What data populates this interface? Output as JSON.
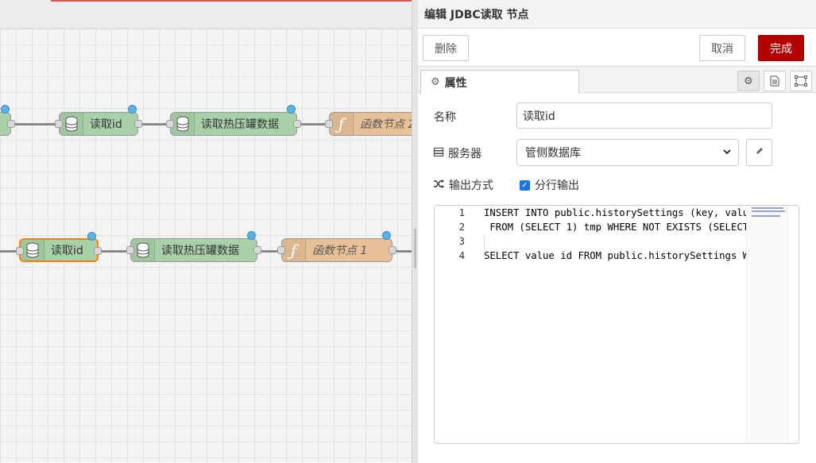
{
  "canvas": {
    "flow_top": {
      "nodes": [
        {
          "label": "读取id",
          "type": "db"
        },
        {
          "label": "读取热压罐数据",
          "type": "db"
        },
        {
          "label": "函数节点 2",
          "type": "function"
        }
      ]
    },
    "flow_bottom": {
      "nodes": [
        {
          "label": "读取id",
          "type": "db",
          "selected": true
        },
        {
          "label": "读取热压罐数据",
          "type": "db"
        },
        {
          "label": "函数节点 1",
          "type": "function"
        }
      ]
    },
    "colors": {
      "db_node": "#a9d1a9",
      "function_node": "#e7c097",
      "status_dot": "#5ab3e6",
      "selected_border": "#ff7f0e"
    }
  },
  "tray": {
    "title": "编辑 JDBC读取 节点",
    "toolbar": {
      "delete_label": "删除",
      "cancel_label": "取消",
      "done_label": "完成",
      "done_color": "#b30000"
    },
    "tabs": {
      "properties_label": "属性",
      "icons": [
        "gear-icon",
        "description-icon",
        "appearance-icon"
      ]
    },
    "form": {
      "name_label": "名称",
      "name_value": "读取id",
      "server_label": "服务器",
      "server_value": "管侧数据库",
      "output_label": "输出方式",
      "output_checkbox_label": "分行输出",
      "output_checked": true
    },
    "editor": {
      "line_numbers": [
        "1",
        "2",
        "3",
        "4"
      ],
      "lines": [
        "INSERT INTO public.historySettings (key, value",
        " FROM (SELECT 1) tmp WHERE NOT EXISTS (SELECT ",
        "",
        "SELECT value id FROM public.historySettings WH"
      ]
    }
  }
}
